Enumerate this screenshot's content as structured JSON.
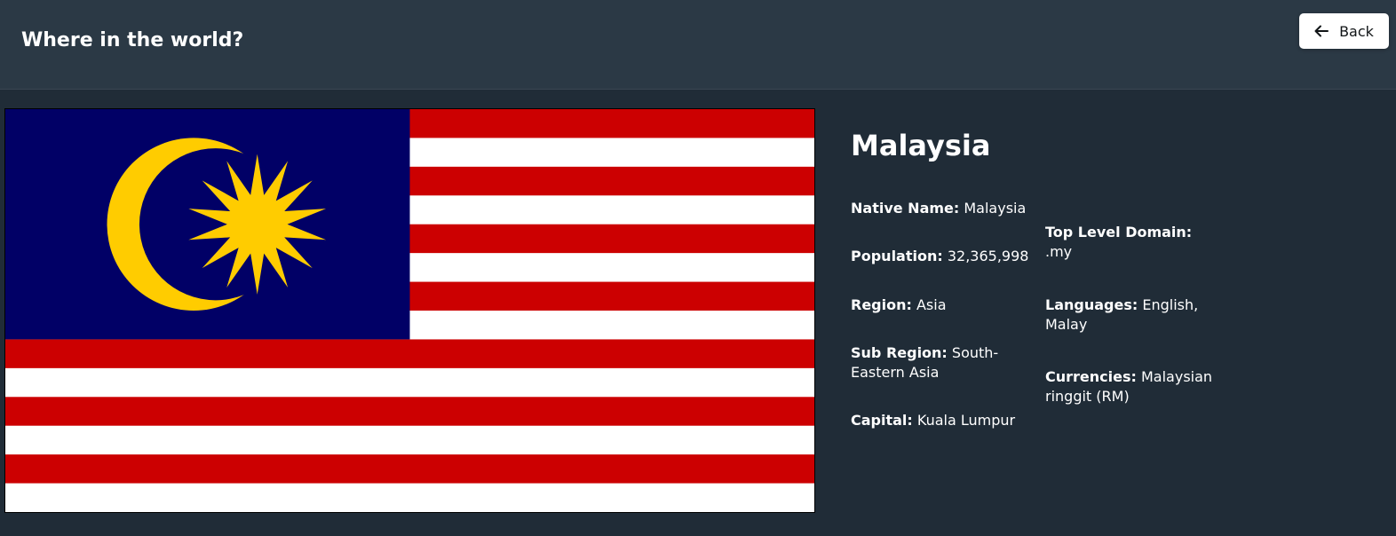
{
  "header": {
    "title": "Where in the world?"
  },
  "back_button": {
    "label": "Back",
    "icon": "arrow-left-icon"
  },
  "flag": {
    "alt": "Flag of Malaysia",
    "colors": {
      "red": "#cc0001",
      "white": "#ffffff",
      "blue": "#010066",
      "yellow": "#ffcc00"
    }
  },
  "country": {
    "name": "Malaysia",
    "native_name_label": "Native Name:",
    "native_name": "Malaysia",
    "population_label": "Population:",
    "population": "32,365,998",
    "region_label": "Region:",
    "region": "Asia",
    "sub_region_label": "Sub Region:",
    "sub_region": "South-Eastern Asia",
    "capital_label": "Capital:",
    "capital": "Kuala Lumpur",
    "tld_label": "Top Level Domain:",
    "tld": ".my",
    "languages_label": "Languages:",
    "languages": "English, Malay",
    "currencies_label": "Currencies:",
    "currencies": "Malaysian ringgit (RM)"
  },
  "colors": {
    "background": "#202c37",
    "header": "#2b3945",
    "text": "#ffffff",
    "button_bg": "#ffffff",
    "button_text": "#111517"
  }
}
